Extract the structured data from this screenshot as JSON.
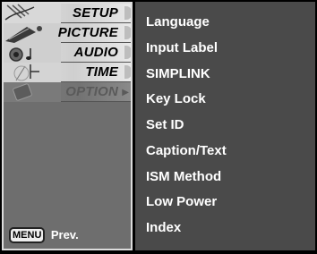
{
  "sidebar": {
    "tabs": [
      {
        "label": "SETUP",
        "icon": "setup-icon",
        "state": "active"
      },
      {
        "label": "PICTURE",
        "icon": "picture-icon",
        "state": "normal"
      },
      {
        "label": "AUDIO",
        "icon": "audio-icon",
        "state": "normal"
      },
      {
        "label": "TIME",
        "icon": "time-icon",
        "state": "normal"
      },
      {
        "label": "OPTION",
        "icon": "option-icon",
        "state": "inactive"
      }
    ],
    "footer": {
      "menu_key": "MENU",
      "prev_label": "Prev."
    }
  },
  "menu": {
    "items": [
      {
        "label": "Language"
      },
      {
        "label": "Input Label"
      },
      {
        "label": "SIMPLINK"
      },
      {
        "label": "Key Lock"
      },
      {
        "label": "Set ID"
      },
      {
        "label": "Caption/Text"
      },
      {
        "label": "ISM Method"
      },
      {
        "label": "Low Power"
      },
      {
        "label": "Index"
      }
    ]
  },
  "colors": {
    "background": "#000000",
    "sidebar_bg": "#6e6e6e",
    "menu_bg": "#4a4a4a",
    "text": "#ffffff"
  }
}
